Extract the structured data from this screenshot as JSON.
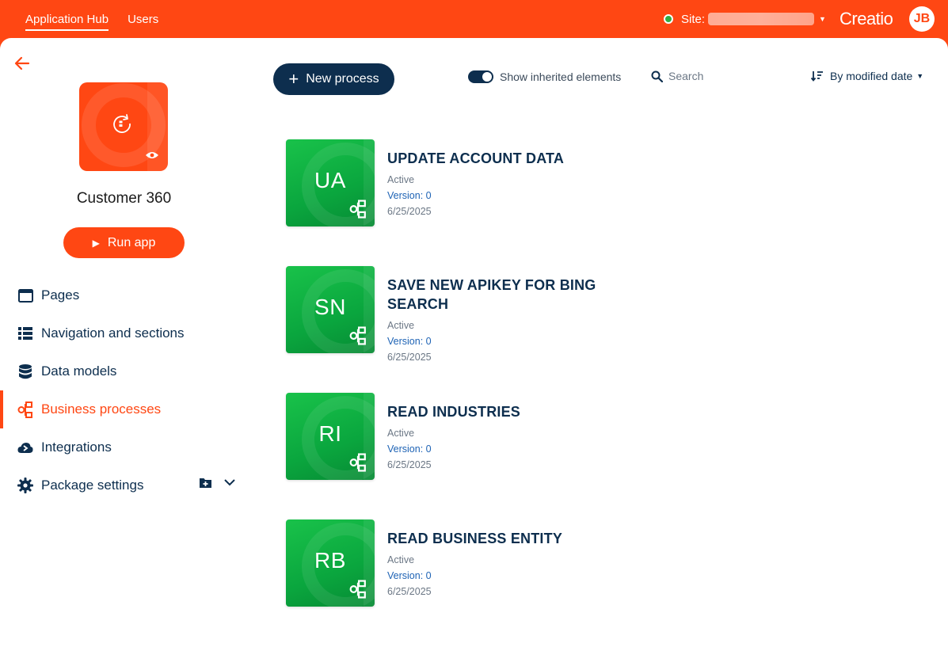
{
  "header": {
    "tabs": [
      {
        "label": "Application Hub",
        "active": true
      },
      {
        "label": "Users",
        "active": false
      }
    ],
    "site_label": "Site:",
    "site_status_color": "#2fae45",
    "logo_text": "Creatio",
    "avatar_initials": "JB"
  },
  "sidebar": {
    "back_icon": "arrow-left-icon",
    "app_name": "Customer 360",
    "run_label": "Run app",
    "items": [
      {
        "label": "Pages",
        "icon": "pages-icon",
        "active": false
      },
      {
        "label": "Navigation and sections",
        "icon": "list-icon",
        "active": false
      },
      {
        "label": "Data models",
        "icon": "database-icon",
        "active": false
      },
      {
        "label": "Business processes",
        "icon": "process-icon",
        "active": true
      },
      {
        "label": "Integrations",
        "icon": "cloud-icon",
        "active": false
      },
      {
        "label": "Package settings",
        "icon": "gear-icon",
        "active": false
      }
    ]
  },
  "toolbar": {
    "new_process_label": "New process",
    "show_inherited_label": "Show inherited elements",
    "show_inherited_on": true,
    "search_placeholder": "Search",
    "sort_label": "By modified date"
  },
  "processes": [
    {
      "abbr": "UA",
      "title": "UPDATE ACCOUNT DATA",
      "status": "Active",
      "version": "Version: 0",
      "date": "6/25/2025"
    },
    {
      "abbr": "SN",
      "title": "SAVE NEW APIKEY FOR BING SEARCH",
      "status": "Active",
      "version": "Version: 0",
      "date": "6/25/2025"
    },
    {
      "abbr": "RI",
      "title": "READ INDUSTRIES",
      "status": "Active",
      "version": "Version: 0",
      "date": "6/25/2025"
    },
    {
      "abbr": "RB",
      "title": "READ BUSINESS ENTITY",
      "status": "Active",
      "version": "Version: 0",
      "date": "6/25/2025"
    }
  ],
  "colors": {
    "brand": "#ff4713",
    "navy": "#0d2e4e",
    "tile_green": "#0aa63e",
    "version_blue": "#1e63b5"
  }
}
